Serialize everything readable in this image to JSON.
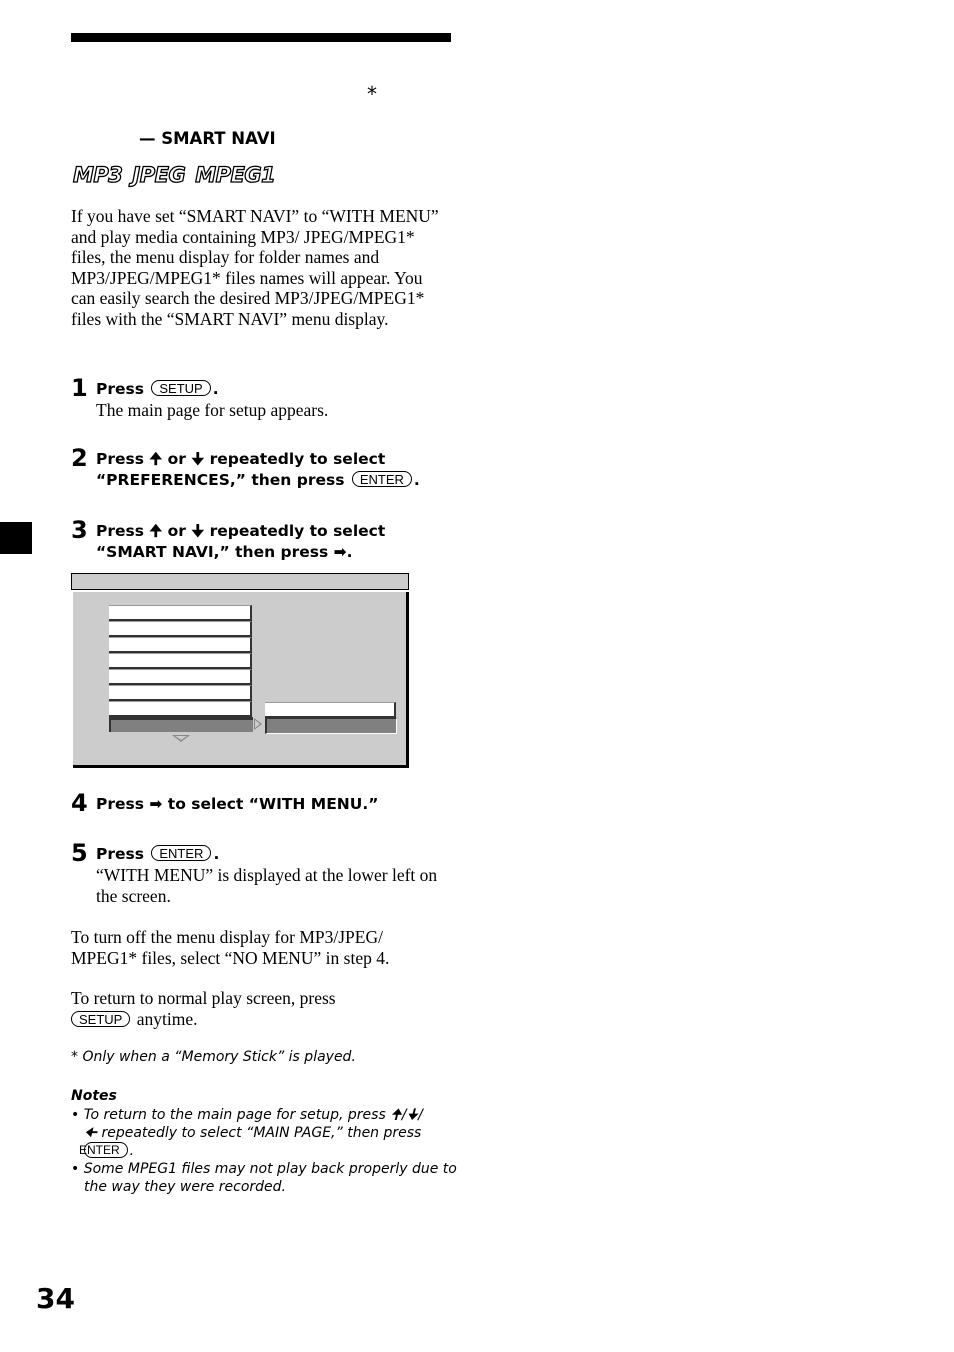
{
  "header": {
    "asterisk": "*",
    "section_title": "— SMART NAVI",
    "format_logos": [
      "MP3",
      "JPEG",
      "MPEG1"
    ]
  },
  "intro": "If you have set “SMART NAVI” to “WITH MENU” and play media containing MP3/ JPEG/MPEG1* files, the menu display for folder names and MP3/JPEG/MPEG1* files names will appear. You can easily search the desired MP3/JPEG/MPEG1* files with the “SMART NAVI” menu display.",
  "steps": [
    {
      "num": "1",
      "pre": "Press",
      "key": "SETUP",
      "post": ".",
      "sub": "The main page for setup appears."
    },
    {
      "num": "2",
      "line1_a": "Press",
      "up": "🠉",
      "or": "or",
      "down": "🠋",
      "line1_b": "repeatedly to select",
      "line2": "“PREFERENCES,” then press",
      "key": "ENTER",
      "post": "."
    },
    {
      "num": "3",
      "line1_a": "Press",
      "up": "🠉",
      "or": "or",
      "down": "🠋",
      "line1_b": "repeatedly to select",
      "line2": "“SMART NAVI,” then press",
      "right": "➡",
      "post": "."
    },
    {
      "num": "4",
      "pre": "Press",
      "right": "➡",
      "post": "to select “WITH MENU.”"
    },
    {
      "num": "5",
      "pre": "Press",
      "key": "ENTER",
      "post": ".",
      "sub": "“WITH MENU” is displayed at the lower left on the screen."
    }
  ],
  "para_turn_off": "To turn off the menu display for MP3/JPEG/ MPEG1* files, select “NO MENU” in step 4.",
  "para_return_a": "To return to normal play screen, press",
  "para_return_key": "SETUP",
  "para_return_b": "anytime.",
  "footnote": "* Only when a “Memory Stick” is played.",
  "notes": {
    "heading": "Notes",
    "note1_a": "• To return to the main page for setup, press 🠉/🠋/",
    "note1_b": "🠈 repeatedly to select “MAIN PAGE,” then press",
    "note1_key": "ENTER",
    "note1_c": ".",
    "note2": "• Some MPEG1 files may not play back properly due to the way they were recorded."
  },
  "page_number": "34"
}
